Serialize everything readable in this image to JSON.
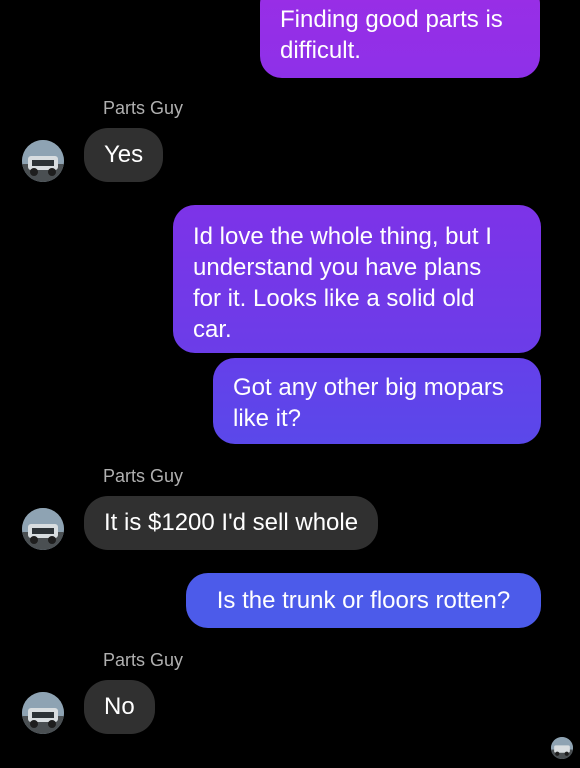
{
  "colors": {
    "background": "#000000",
    "incoming_bubble": "#303030",
    "outgoing_top": "#9a2ee6",
    "outgoing_mid": "#6b3de8",
    "outgoing_bottom": "#4c5bea",
    "sender_text": "#b0b0b0"
  },
  "messages": [
    {
      "direction": "outgoing",
      "text": "Finding good parts is\ndifficult."
    },
    {
      "direction": "incoming",
      "sender": "Parts Guy",
      "text": "Yes"
    },
    {
      "direction": "outgoing",
      "text": "Id love the whole thing, but I\nunderstand you have plans\nfor it. Looks like a solid old\ncar."
    },
    {
      "direction": "outgoing",
      "text": "Got any other big mopars\nlike it?"
    },
    {
      "direction": "incoming",
      "sender": "Parts Guy",
      "text": "It is $1200 I'd sell whole"
    },
    {
      "direction": "outgoing",
      "text": "Is the trunk or floors rotten?"
    },
    {
      "direction": "incoming",
      "sender": "Parts Guy",
      "text": "No"
    }
  ],
  "icons": {
    "avatar": "contact-photo-icon",
    "read_receipt": "seen-avatar-icon"
  }
}
